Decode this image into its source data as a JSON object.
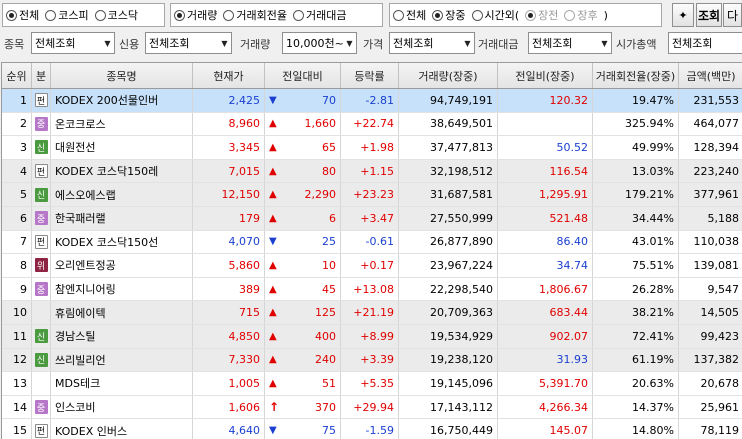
{
  "radio_market": {
    "options": [
      {
        "label": "전체",
        "checked": true
      },
      {
        "label": "코스피",
        "checked": false
      },
      {
        "label": "코스닥",
        "checked": false
      }
    ]
  },
  "radio_sort": {
    "options": [
      {
        "label": "거래량",
        "checked": true
      },
      {
        "label": "거래회전율",
        "checked": false
      },
      {
        "label": "거래대금",
        "checked": false
      }
    ]
  },
  "radio_session": {
    "options": [
      {
        "label": "전체",
        "checked": false
      },
      {
        "label": "장중",
        "checked": true
      },
      {
        "label": "시간외(",
        "checked": false
      },
      {
        "label": "장전",
        "checked": true,
        "disabled": true
      },
      {
        "label": "장후",
        "checked": false,
        "disabled": true
      }
    ],
    "close_paren": ")"
  },
  "toolbar": {
    "pin_icon": "pin-icon",
    "query_label": "조회",
    "next_label": "다"
  },
  "filters": {
    "category_label": "종목",
    "category_value": "전체조회",
    "credit_label": "신용",
    "credit_value": "전체조회",
    "volume_label": "거래량",
    "volume_value": "10,000천~1",
    "price_label": "가격",
    "price_value": "전체조회",
    "amount_label": "거래대금",
    "amount_value": "전체조회",
    "mcap_label": "시가총액",
    "mcap_value": "전체조회"
  },
  "table": {
    "headers": [
      "순위",
      "분",
      "종목명",
      "현재가",
      "전일대비",
      "등락률",
      "거래량(장중)",
      "전일비(장중)",
      "거래회전율(장중)",
      "금액(백만)"
    ],
    "rows": [
      {
        "rank": "1",
        "badge": "펀",
        "badge_type": "fund",
        "name": "KODEX 200선물인버",
        "price": "2,425",
        "dir": "down",
        "change": "70",
        "rate": "-2.81",
        "volume": "94,749,191",
        "vol_ratio": "120.32",
        "vol_ratio_dir": "up",
        "turnover": "19.47%",
        "amount": "231,553",
        "selected": true
      },
      {
        "rank": "2",
        "badge": "중",
        "badge_type": "j",
        "name": "온코크로스",
        "price": "8,960",
        "dir": "up",
        "change": "1,660",
        "rate": "+22.74",
        "volume": "38,649,501",
        "vol_ratio": "",
        "vol_ratio_dir": "",
        "turnover": "325.94%",
        "amount": "464,077"
      },
      {
        "rank": "3",
        "badge": "신",
        "badge_type": "sh",
        "name": "대원전선",
        "price": "3,345",
        "dir": "up",
        "change": "65",
        "rate": "+1.98",
        "volume": "37,477,813",
        "vol_ratio": "50.52",
        "vol_ratio_dir": "down",
        "turnover": "49.99%",
        "amount": "128,394"
      },
      {
        "rank": "4",
        "badge": "펀",
        "badge_type": "fund",
        "name": "KODEX 코스닥150레",
        "price": "7,015",
        "dir": "up",
        "change": "80",
        "rate": "+1.15",
        "volume": "32,198,512",
        "vol_ratio": "116.54",
        "vol_ratio_dir": "up",
        "turnover": "13.03%",
        "amount": "223,240",
        "group": true
      },
      {
        "rank": "5",
        "badge": "신",
        "badge_type": "sh",
        "name": "에스오에스랩",
        "price": "12,150",
        "dir": "up",
        "change": "2,290",
        "rate": "+23.23",
        "volume": "31,687,581",
        "vol_ratio": "1,295.91",
        "vol_ratio_dir": "up",
        "turnover": "179.21%",
        "amount": "377,961",
        "group": true
      },
      {
        "rank": "6",
        "badge": "중",
        "badge_type": "j",
        "name": "한국패러랠",
        "price": "179",
        "dir": "up",
        "change": "6",
        "rate": "+3.47",
        "volume": "27,550,999",
        "vol_ratio": "521.48",
        "vol_ratio_dir": "up",
        "turnover": "34.44%",
        "amount": "5,188",
        "group": true
      },
      {
        "rank": "7",
        "badge": "펀",
        "badge_type": "fund",
        "name": "KODEX 코스닥150선",
        "price": "4,070",
        "dir": "down",
        "change": "25",
        "rate": "-0.61",
        "volume": "26,877,890",
        "vol_ratio": "86.40",
        "vol_ratio_dir": "down",
        "turnover": "43.01%",
        "amount": "110,038"
      },
      {
        "rank": "8",
        "badge": "위",
        "badge_type": "w",
        "name": "오리엔트정공",
        "price": "5,860",
        "dir": "up",
        "change": "10",
        "rate": "+0.17",
        "volume": "23,967,224",
        "vol_ratio": "34.74",
        "vol_ratio_dir": "down",
        "turnover": "75.51%",
        "amount": "139,081"
      },
      {
        "rank": "9",
        "badge": "중",
        "badge_type": "j",
        "name": "참엔지니어링",
        "price": "389",
        "dir": "up",
        "change": "45",
        "rate": "+13.08",
        "volume": "22,298,540",
        "vol_ratio": "1,806.67",
        "vol_ratio_dir": "up",
        "turnover": "26.28%",
        "amount": "9,547"
      },
      {
        "rank": "10",
        "badge": "",
        "badge_type": "",
        "name": "휴림에이텍",
        "price": "715",
        "dir": "up",
        "change": "125",
        "rate": "+21.19",
        "volume": "20,709,363",
        "vol_ratio": "683.44",
        "vol_ratio_dir": "up",
        "turnover": "38.21%",
        "amount": "14,505",
        "group": true
      },
      {
        "rank": "11",
        "badge": "신",
        "badge_type": "sh",
        "name": "경남스틸",
        "price": "4,850",
        "dir": "up",
        "change": "400",
        "rate": "+8.99",
        "volume": "19,534,929",
        "vol_ratio": "902.07",
        "vol_ratio_dir": "up",
        "turnover": "72.41%",
        "amount": "99,423",
        "group": true
      },
      {
        "rank": "12",
        "badge": "신",
        "badge_type": "sh",
        "name": "쓰리빌리언",
        "price": "7,330",
        "dir": "up",
        "change": "240",
        "rate": "+3.39",
        "volume": "19,238,120",
        "vol_ratio": "31.93",
        "vol_ratio_dir": "down",
        "turnover": "61.19%",
        "amount": "137,382",
        "group": true
      },
      {
        "rank": "13",
        "badge": "",
        "badge_type": "",
        "name": "MDS테크",
        "price": "1,005",
        "dir": "up",
        "change": "51",
        "rate": "+5.35",
        "volume": "19,145,096",
        "vol_ratio": "5,391.70",
        "vol_ratio_dir": "up",
        "turnover": "20.63%",
        "amount": "20,678"
      },
      {
        "rank": "14",
        "badge": "중",
        "badge_type": "j",
        "name": "인스코비",
        "price": "1,606",
        "dir": "uplimit",
        "change": "370",
        "rate": "+29.94",
        "volume": "17,143,112",
        "vol_ratio": "4,266.34",
        "vol_ratio_dir": "up",
        "turnover": "14.37%",
        "amount": "25,961"
      },
      {
        "rank": "15",
        "badge": "펀",
        "badge_type": "fund",
        "name": "KODEX 인버스",
        "price": "4,640",
        "dir": "down",
        "change": "75",
        "rate": "-1.59",
        "volume": "16,750,449",
        "vol_ratio": "145.07",
        "vol_ratio_dir": "up",
        "turnover": "14.80%",
        "amount": "78,119"
      }
    ]
  },
  "colors": {
    "up": "#e00000",
    "down": "#1a3fd0",
    "selected_row": "#c7e1fa",
    "group_row": "#ebebeb"
  }
}
